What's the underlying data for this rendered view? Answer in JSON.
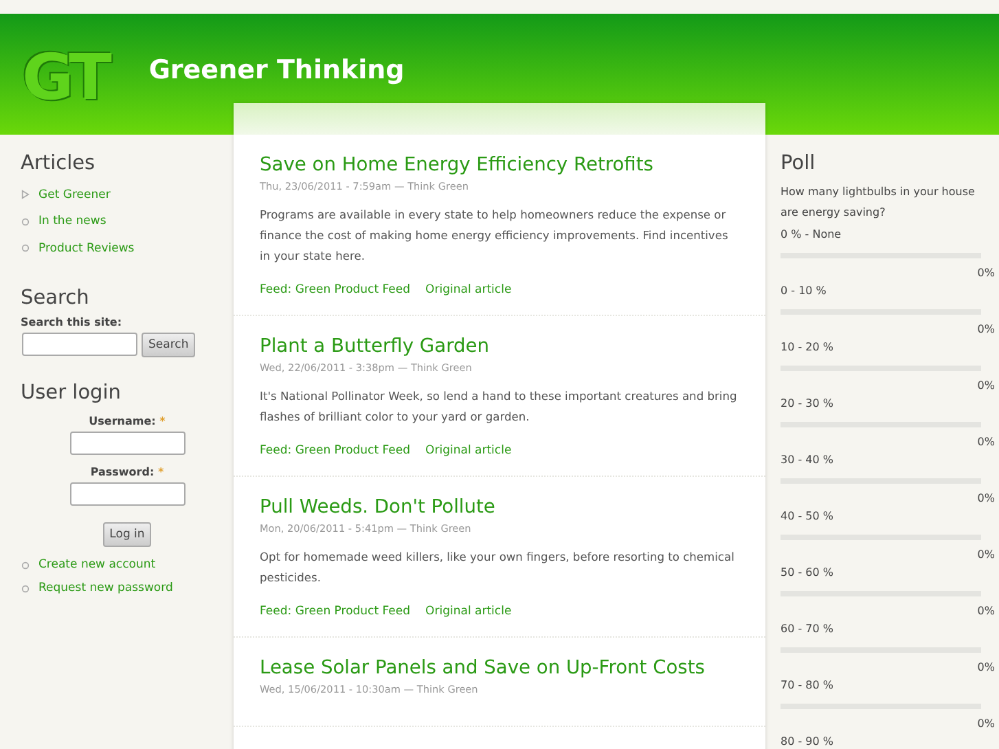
{
  "site": {
    "logo_text": "GT",
    "name": "Greener Thinking"
  },
  "sidebar_left": {
    "articles": {
      "title": "Articles",
      "items": [
        {
          "label": "Get Greener",
          "expanded": false
        },
        {
          "label": "In the news"
        },
        {
          "label": "Product Reviews"
        }
      ]
    },
    "search": {
      "title": "Search",
      "label": "Search this site:",
      "button": "Search"
    },
    "login": {
      "title": "User login",
      "fields": [
        {
          "label": "Username:",
          "required": "*"
        },
        {
          "label": "Password:",
          "required": "*"
        }
      ],
      "button": "Log in",
      "links": [
        "Create new account",
        "Request new password"
      ]
    }
  },
  "articles": [
    {
      "title": "Save on Home Energy Efficiency Retrofits",
      "meta": "Thu, 23/06/2011 - 7:59am — Think Green",
      "body": "Programs are available in every state to help homeowners reduce the expense or finance the cost of making home energy efficiency improvements. Find incentives in your state here.",
      "links": [
        "Feed: Green Product Feed",
        "Original article"
      ]
    },
    {
      "title": "Plant a Butterfly Garden",
      "meta": "Wed, 22/06/2011 - 3:38pm — Think Green",
      "body": "It's National Pollinator Week, so lend a hand to these important creatures and bring flashes of brilliant color to your yard or garden.",
      "links": [
        "Feed: Green Product Feed",
        "Original article"
      ]
    },
    {
      "title": "Pull Weeds. Don't Pollute",
      "meta": "Mon, 20/06/2011 - 5:41pm — Think Green",
      "body": "Opt for homemade weed killers, like your own fingers, before resorting to chemical pesticides.",
      "links": [
        "Feed: Green Product Feed",
        "Original article"
      ]
    },
    {
      "title": "Lease Solar Panels and Save on Up-Front Costs",
      "meta": "Wed, 15/06/2011 - 10:30am — Think Green"
    }
  ],
  "poll": {
    "title": "Poll",
    "question": "How many lightbulbs in your house are energy saving?",
    "choices": [
      {
        "label": "0 % - None",
        "level": 0,
        "percent": "0%"
      },
      {
        "label": "0 - 10 %",
        "level": 0,
        "percent": "0%"
      },
      {
        "label": "10 - 20 %",
        "level": 0,
        "percent": "0%"
      },
      {
        "label": "20 - 30 %",
        "level": 0,
        "percent": "0%"
      },
      {
        "label": "30 - 40 %",
        "level": 0,
        "percent": "0%"
      },
      {
        "label": "40 - 50 %",
        "level": 0,
        "percent": "0%"
      },
      {
        "label": "50 - 60 %",
        "level": 0,
        "percent": "0%"
      },
      {
        "label": "60 - 70 %",
        "level": 0,
        "percent": "0%"
      },
      {
        "label": "70 - 80 %",
        "level": 0,
        "percent": "0%"
      },
      {
        "label": "80 - 90 %"
      }
    ]
  }
}
